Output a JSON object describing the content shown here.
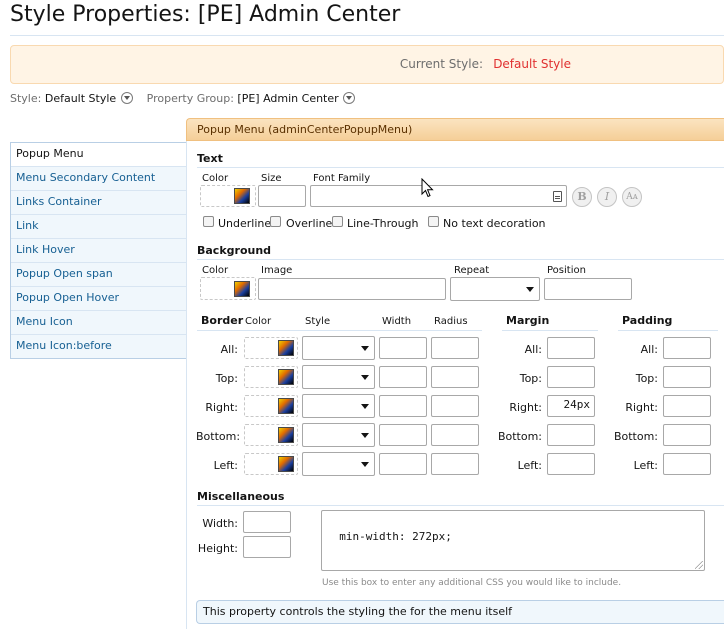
{
  "page": {
    "title": "Style Properties: [PE] Admin Center"
  },
  "current_style": {
    "label": "Current Style:",
    "value": "Default Style"
  },
  "filters": {
    "style_label": "Style:",
    "style_value": "Default Style",
    "group_label": "Property Group:",
    "group_value": "[PE] Admin Center"
  },
  "sidebar": {
    "items": [
      {
        "label": "Popup Menu",
        "active": true
      },
      {
        "label": "Menu Secondary Content"
      },
      {
        "label": "Links Container"
      },
      {
        "label": "Link"
      },
      {
        "label": "Link Hover"
      },
      {
        "label": "Popup Open span"
      },
      {
        "label": "Popup Open Hover"
      },
      {
        "label": "Menu Icon"
      },
      {
        "label": "Menu Icon:before"
      }
    ]
  },
  "panel": {
    "header_title": "Popup Menu",
    "header_key": "(adminCenterPopupMenu)"
  },
  "text_section": {
    "title": "Text",
    "color_label": "Color",
    "size_label": "Size",
    "font_family_label": "Font Family",
    "size_value": "",
    "font_family_value": "",
    "bold_label": "B",
    "italic_label": "I",
    "case_label": "Aᴀ",
    "decorations": [
      "Underline",
      "Overline",
      "Line-Through",
      "No text decoration"
    ]
  },
  "background_section": {
    "title": "Background",
    "color_label": "Color",
    "image_label": "Image",
    "repeat_label": "Repeat",
    "position_label": "Position",
    "image_value": "",
    "position_value": ""
  },
  "border_section": {
    "title": "Border",
    "color_label": "Color",
    "style_label": "Style",
    "width_label": "Width",
    "radius_label": "Radius",
    "rows": [
      "All:",
      "Top:",
      "Right:",
      "Bottom:",
      "Left:"
    ]
  },
  "margin_section": {
    "title": "Margin",
    "rows": [
      {
        "label": "All:",
        "value": ""
      },
      {
        "label": "Top:",
        "value": ""
      },
      {
        "label": "Right:",
        "value": "24px"
      },
      {
        "label": "Bottom:",
        "value": ""
      },
      {
        "label": "Left:",
        "value": ""
      }
    ]
  },
  "padding_section": {
    "title": "Padding",
    "rows": [
      "All:",
      "Top:",
      "Right:",
      "Bottom:",
      "Left:"
    ]
  },
  "misc_section": {
    "title": "Miscellaneous",
    "width_label": "Width:",
    "height_label": "Height:",
    "width_value": "",
    "height_value": "",
    "extra_css": "min-width: 272px;",
    "hint": "Use this box to enter any additional CSS you would like to include."
  },
  "description": "This property controls the styling the for the menu itself",
  "colors": {
    "accent": "#e03030",
    "header_bg": "#f5cf98",
    "link": "#176093"
  }
}
